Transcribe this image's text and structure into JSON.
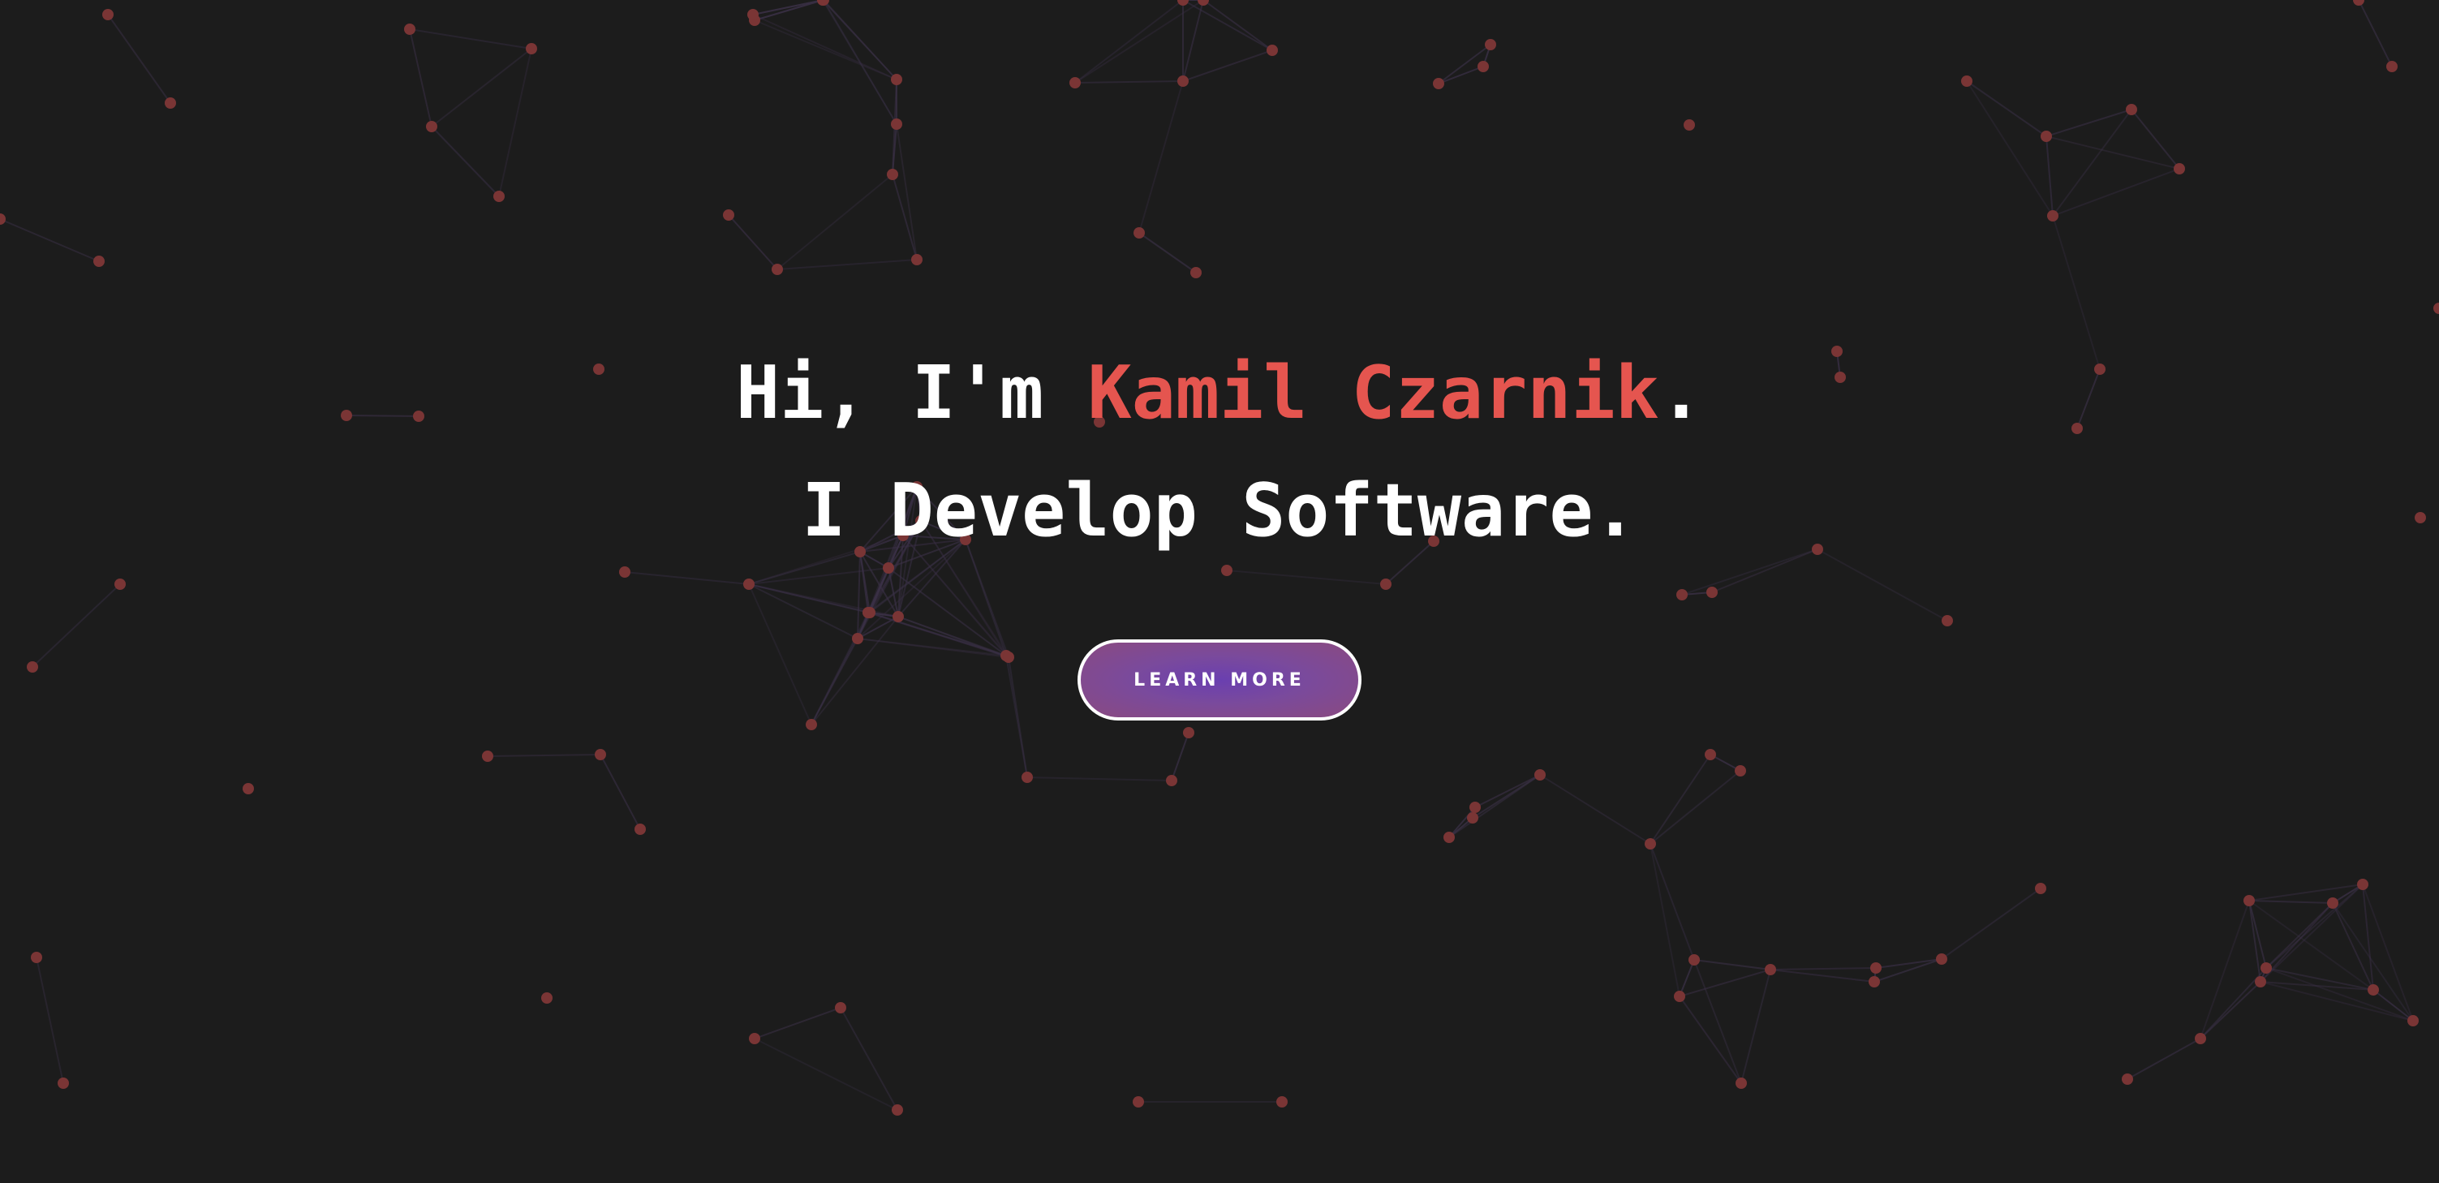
{
  "hero": {
    "greeting_prefix": "Hi, I'm ",
    "name": "Kamil Czarnik",
    "greeting_suffix": ".",
    "tagline": "I Develop Software.",
    "cta_label": "LEARN MORE"
  },
  "colors": {
    "background": "#1c1c1c",
    "accent": "#e5554f",
    "node": "#7a3535",
    "link": "#3a3046",
    "button_gradient": [
      "#6a3fb0",
      "#8a4a80"
    ]
  }
}
